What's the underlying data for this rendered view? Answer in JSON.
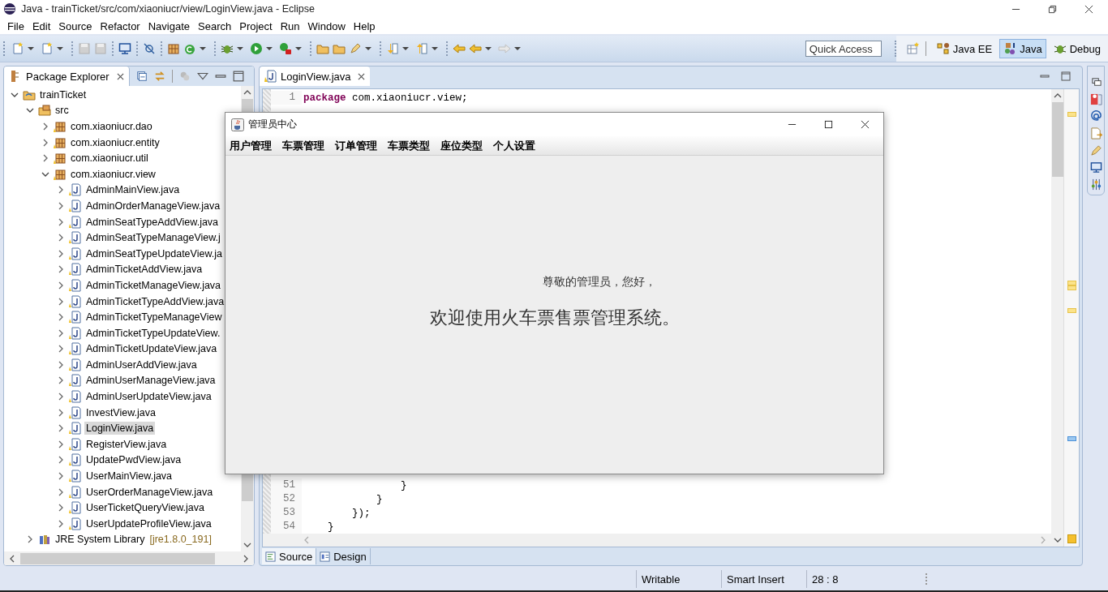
{
  "window": {
    "title": "Java - trainTicket/src/com/xiaoniucr/view/LoginView.java - Eclipse"
  },
  "menu": [
    "File",
    "Edit",
    "Source",
    "Refactor",
    "Navigate",
    "Search",
    "Project",
    "Run",
    "Window",
    "Help"
  ],
  "quick_access": {
    "placeholder": "Quick Access"
  },
  "perspectives": [
    {
      "label": "Java EE",
      "selected": false
    },
    {
      "label": "Java",
      "selected": true
    },
    {
      "label": "Debug",
      "selected": false
    }
  ],
  "package_explorer": {
    "title": "Package Explorer",
    "tree": [
      {
        "label": "trainTicket",
        "kind": "project",
        "expanded": true,
        "selected": false,
        "children": [
          {
            "label": "src",
            "kind": "source",
            "expanded": true,
            "selected": false,
            "children": [
              {
                "label": "com.xiaoniucr.dao",
                "kind": "package",
                "expanded": false,
                "selected": false
              },
              {
                "label": "com.xiaoniucr.entity",
                "kind": "package",
                "expanded": false,
                "selected": false
              },
              {
                "label": "com.xiaoniucr.util",
                "kind": "package",
                "expanded": false,
                "selected": false
              },
              {
                "label": "com.xiaoniucr.view",
                "kind": "package",
                "expanded": true,
                "selected": false,
                "children": [
                  {
                    "label": "AdminMainView.java",
                    "kind": "file",
                    "expanded": false,
                    "selected": false
                  },
                  {
                    "label": "AdminOrderManageView.java",
                    "kind": "file",
                    "expanded": false,
                    "selected": false
                  },
                  {
                    "label": "AdminSeatTypeAddView.java",
                    "kind": "file",
                    "expanded": false,
                    "selected": false
                  },
                  {
                    "label": "AdminSeatTypeManageView.j",
                    "kind": "file",
                    "expanded": false,
                    "selected": false
                  },
                  {
                    "label": "AdminSeatTypeUpdateView.ja",
                    "kind": "file",
                    "expanded": false,
                    "selected": false
                  },
                  {
                    "label": "AdminTicketAddView.java",
                    "kind": "file",
                    "expanded": false,
                    "selected": false
                  },
                  {
                    "label": "AdminTicketManageView.java",
                    "kind": "file",
                    "expanded": false,
                    "selected": false
                  },
                  {
                    "label": "AdminTicketTypeAddView.java",
                    "kind": "file",
                    "expanded": false,
                    "selected": false
                  },
                  {
                    "label": "AdminTicketTypeManageView",
                    "kind": "file",
                    "expanded": false,
                    "selected": false
                  },
                  {
                    "label": "AdminTicketTypeUpdateView.",
                    "kind": "file",
                    "expanded": false,
                    "selected": false
                  },
                  {
                    "label": "AdminTicketUpdateView.java",
                    "kind": "file",
                    "expanded": false,
                    "selected": false
                  },
                  {
                    "label": "AdminUserAddView.java",
                    "kind": "file",
                    "expanded": false,
                    "selected": false
                  },
                  {
                    "label": "AdminUserManageView.java",
                    "kind": "file",
                    "expanded": false,
                    "selected": false
                  },
                  {
                    "label": "AdminUserUpdateView.java",
                    "kind": "file",
                    "expanded": false,
                    "selected": false
                  },
                  {
                    "label": "InvestView.java",
                    "kind": "file",
                    "expanded": false,
                    "selected": false
                  },
                  {
                    "label": "LoginView.java",
                    "kind": "file",
                    "expanded": false,
                    "selected": true
                  },
                  {
                    "label": "RegisterView.java",
                    "kind": "file",
                    "expanded": false,
                    "selected": false
                  },
                  {
                    "label": "UpdatePwdView.java",
                    "kind": "file",
                    "expanded": false,
                    "selected": false
                  },
                  {
                    "label": "UserMainView.java",
                    "kind": "file",
                    "expanded": false,
                    "selected": false
                  },
                  {
                    "label": "UserOrderManageView.java",
                    "kind": "file",
                    "expanded": false,
                    "selected": false
                  },
                  {
                    "label": "UserTicketQueryView.java",
                    "kind": "file",
                    "expanded": false,
                    "selected": false
                  },
                  {
                    "label": "UserUpdateProfileView.java",
                    "kind": "file",
                    "expanded": false,
                    "selected": false
                  }
                ]
              }
            ]
          },
          {
            "label": "JRE System Library",
            "kind": "library",
            "expanded": false,
            "selected": false,
            "decoration": "[jre1.8.0_191]"
          }
        ]
      }
    ]
  },
  "editor": {
    "tabs": [
      {
        "label": "LoginView.java",
        "selected": true
      }
    ],
    "lines": [
      {
        "number": "1",
        "keyword": "package",
        "code": " com.xiaoniucr.view;"
      },
      {
        "number": "51",
        "code": "                }"
      },
      {
        "number": "52",
        "code": "            }"
      },
      {
        "number": "53",
        "code": "        });"
      },
      {
        "number": "54",
        "code": "    }"
      }
    ],
    "bottom_tabs": [
      {
        "label": "Source",
        "selected": true
      },
      {
        "label": "Design",
        "selected": false
      }
    ]
  },
  "status_bar": {
    "mode": "Writable",
    "insert": "Smart Insert",
    "position": "28 : 8"
  },
  "dialog": {
    "title": "管理员中心",
    "menu": [
      "用户管理",
      "车票管理",
      "订单管理",
      "车票类型",
      "座位类型",
      "个人设置"
    ],
    "greeting": "尊敬的管理员，您好，",
    "welcome": "欢迎使用火车票售票管理系统。"
  }
}
